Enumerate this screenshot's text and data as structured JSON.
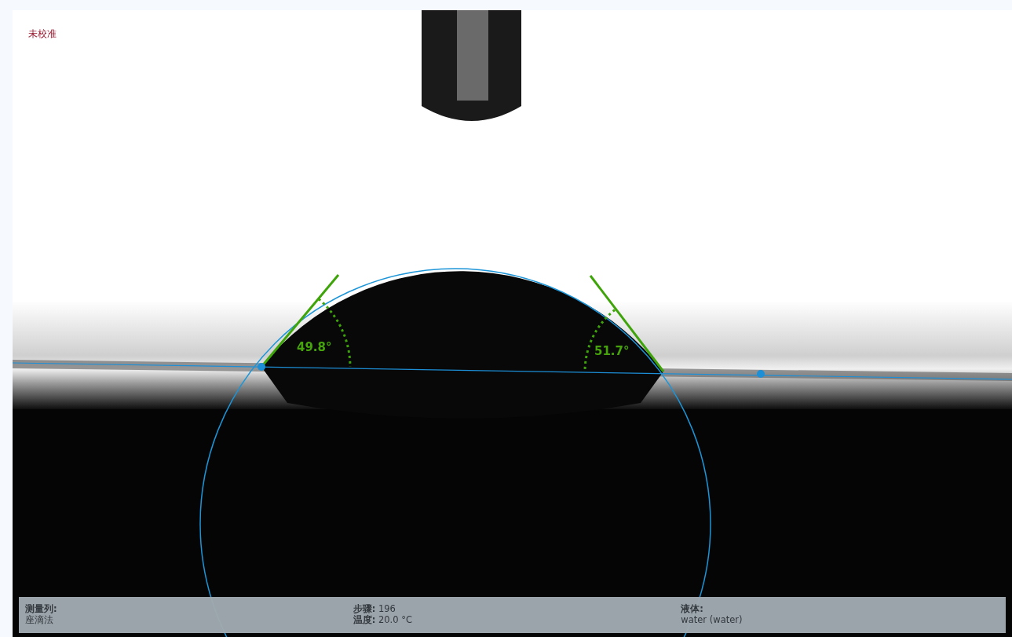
{
  "calibration_status": "未校准",
  "angles": [
    {
      "kind": "left",
      "label": "49.8°"
    },
    {
      "kind": "right",
      "label": "51.7°"
    }
  ],
  "info_bar": {
    "columns": [
      {
        "lines": [
          {
            "label": "测量列:"
          },
          {
            "value": "座滴法"
          }
        ]
      },
      {
        "lines": [
          {
            "label": "步骤:",
            "value": "196"
          },
          {
            "label": "温度:",
            "value": " 20.0 °C"
          }
        ]
      },
      {
        "lines": [
          {
            "label": "液体:"
          },
          {
            "value": "water (water)"
          }
        ]
      }
    ]
  }
}
